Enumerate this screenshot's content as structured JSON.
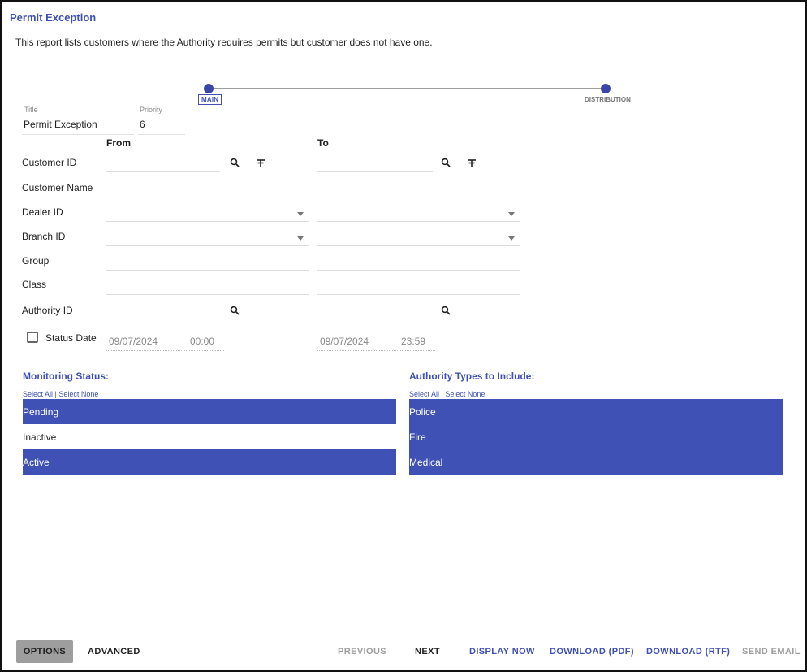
{
  "page": {
    "title": "Permit Exception",
    "description": "This report lists customers where the Authority requires permits but customer does not have one."
  },
  "stepper": {
    "steps": [
      {
        "label": "MAIN"
      },
      {
        "label": "DISTRIBUTION"
      }
    ]
  },
  "report": {
    "title_label": "Title",
    "title_value": "Permit Exception",
    "priority_label": "Priority",
    "priority_value": "6"
  },
  "columns": {
    "from": "From",
    "to": "To"
  },
  "rows": {
    "customer_id": "Customer ID",
    "customer_name": "Customer Name",
    "dealer_id": "Dealer ID",
    "branch_id": "Branch ID",
    "group": "Group",
    "class": "Class",
    "authority_id": "Authority ID",
    "status_date": "Status Date"
  },
  "status_date": {
    "checked": false,
    "from_date": "09/07/2024",
    "from_time": "00:00",
    "to_date": "09/07/2024",
    "to_time": "23:59"
  },
  "monitoring_status": {
    "title": "Monitoring Status:",
    "select_all": "Select All",
    "separator": "|",
    "select_none": "Select None",
    "items": [
      {
        "label": "Pending",
        "selected": true
      },
      {
        "label": "Inactive",
        "selected": false
      },
      {
        "label": "Active",
        "selected": true
      }
    ]
  },
  "authority_types": {
    "title": "Authority Types to Include:",
    "select_all": "Select All",
    "separator": "|",
    "select_none": "Select None",
    "items": [
      {
        "label": "Police",
        "selected": true
      },
      {
        "label": "Fire",
        "selected": true
      },
      {
        "label": "Medical",
        "selected": true
      }
    ]
  },
  "buttons": {
    "options": "OPTIONS",
    "advanced": "ADVANCED",
    "previous": "PREVIOUS",
    "next": "NEXT",
    "display_now": "DISPLAY NOW",
    "download_pdf": "DOWNLOAD (PDF)",
    "download_rtf": "DOWNLOAD (RTF)",
    "send_email": "SEND EMAIL"
  },
  "colors": {
    "accent": "#3f51b5",
    "selected_bg": "#3f51b5",
    "disabled_text": "#9e9e9e"
  },
  "icons": {
    "search": "search-icon",
    "filter": "filter-icon",
    "dropdown": "chevron-down-icon"
  }
}
